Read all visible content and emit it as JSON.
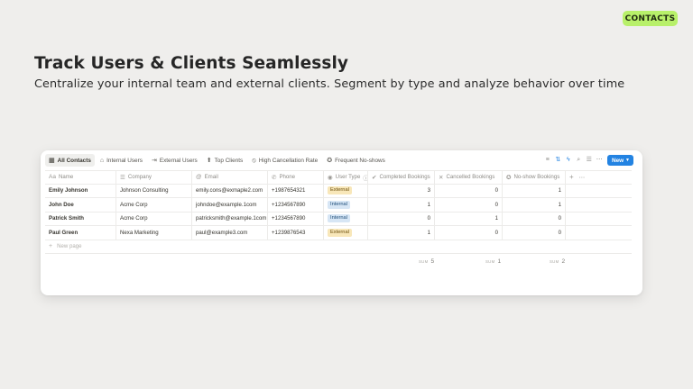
{
  "badge": "CONTACTS",
  "headline": "Track Users & Clients Seamlessly",
  "subline": "Centralize your internal team and external clients. Segment by type and analyze behavior over time",
  "views": [
    {
      "label": "All Contacts",
      "icon": "table-icon"
    },
    {
      "label": "Internal Users",
      "icon": "home-icon"
    },
    {
      "label": "External Users",
      "icon": "external-arrow-icon"
    },
    {
      "label": "Top Clients",
      "icon": "arrow-up-icon"
    },
    {
      "label": "High Cancellation Rate",
      "icon": "ban-icon"
    },
    {
      "label": "Frequent No-shows",
      "icon": "badge-icon"
    }
  ],
  "toolbar": {
    "new_label": "New"
  },
  "columns": {
    "name": "Name",
    "company": "Company",
    "email": "Email",
    "phone": "Phone",
    "user_type": "User Type",
    "completed": "Completed Bookings",
    "cancelled": "Cancelled Bookings",
    "noshow": "No-show Bookings"
  },
  "rows": [
    {
      "name": "Emily Johnson",
      "company": "Johnson Consulting",
      "email": "emily.cons@exmaple2.com",
      "phone": "+1987654321",
      "user_type": "External",
      "completed": "3",
      "cancelled": "0",
      "noshow": "1"
    },
    {
      "name": "John Doe",
      "company": "Acme Corp",
      "email": "johndoe@example.1com",
      "phone": "+1234567890",
      "user_type": "Internal",
      "completed": "1",
      "cancelled": "0",
      "noshow": "1"
    },
    {
      "name": "Patrick Smith",
      "company": "Acme Corp",
      "email": "patricksmith@example.1com",
      "phone": "+1234567890",
      "user_type": "Internal",
      "completed": "0",
      "cancelled": "1",
      "noshow": "0"
    },
    {
      "name": "Paul Green",
      "company": "Nexa Marketing",
      "email": "paul@example3.com",
      "phone": "+1239876543",
      "user_type": "External",
      "completed": "1",
      "cancelled": "0",
      "noshow": "0"
    }
  ],
  "new_page_label": "New page",
  "sums": {
    "label": "SUM",
    "completed": "5",
    "cancelled": "1",
    "noshow": "2"
  },
  "colors": {
    "accent": "#2383e2",
    "badge": "#b8f06a",
    "external_tag": "#f8e7b9",
    "internal_tag": "#d7e6f5"
  }
}
